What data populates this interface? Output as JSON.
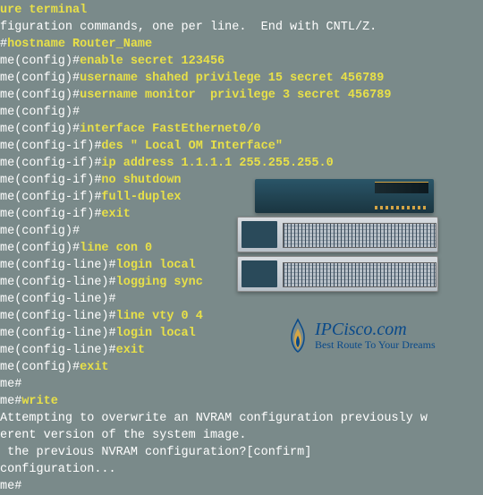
{
  "terminal": {
    "lines": [
      [
        {
          "t": "ure terminal",
          "c": "y"
        }
      ],
      [
        {
          "t": "figuration commands, one per line.  End with CNTL/Z.",
          "c": "w"
        }
      ],
      [
        {
          "t": "#",
          "c": "w"
        },
        {
          "t": "hostname Router_Name",
          "c": "y"
        }
      ],
      [
        {
          "t": "me(config)#",
          "c": "w"
        },
        {
          "t": "enable secret 123456",
          "c": "y"
        }
      ],
      [
        {
          "t": "me(config)#",
          "c": "w"
        },
        {
          "t": "username shahed privilege 15 secret 456789",
          "c": "y"
        }
      ],
      [
        {
          "t": "me(config)#",
          "c": "w"
        },
        {
          "t": "username monitor  privilege 3 secret 456789",
          "c": "y"
        }
      ],
      [
        {
          "t": "me(config)#",
          "c": "w"
        }
      ],
      [
        {
          "t": "me(config)#",
          "c": "w"
        },
        {
          "t": "interface FastEthernet0/0",
          "c": "y"
        }
      ],
      [
        {
          "t": "me(config-if)#",
          "c": "w"
        },
        {
          "t": "des \" Local OM Interface\"",
          "c": "y"
        }
      ],
      [
        {
          "t": "me(config-if)#",
          "c": "w"
        },
        {
          "t": "ip address 1.1.1.1 255.255.255.0",
          "c": "y"
        }
      ],
      [
        {
          "t": "me(config-if)#",
          "c": "w"
        },
        {
          "t": "no shutdown",
          "c": "y"
        }
      ],
      [
        {
          "t": "me(config-if)#",
          "c": "w"
        },
        {
          "t": "full-duplex",
          "c": "y"
        }
      ],
      [
        {
          "t": "me(config-if)#",
          "c": "w"
        },
        {
          "t": "exit",
          "c": "y"
        }
      ],
      [
        {
          "t": "me(config)#",
          "c": "w"
        }
      ],
      [
        {
          "t": "me(config)#",
          "c": "w"
        },
        {
          "t": "line con 0",
          "c": "y"
        }
      ],
      [
        {
          "t": "me(config-line)#",
          "c": "w"
        },
        {
          "t": "login local",
          "c": "y"
        }
      ],
      [
        {
          "t": "me(config-line)#",
          "c": "w"
        },
        {
          "t": "logging sync",
          "c": "y"
        }
      ],
      [
        {
          "t": "me(config-line)#",
          "c": "w"
        }
      ],
      [
        {
          "t": "me(config-line)#",
          "c": "w"
        },
        {
          "t": "line vty 0 4",
          "c": "y"
        }
      ],
      [
        {
          "t": "me(config-line)#",
          "c": "w"
        },
        {
          "t": "login local",
          "c": "y"
        }
      ],
      [
        {
          "t": "me(config-line)#",
          "c": "w"
        },
        {
          "t": "exit",
          "c": "y"
        }
      ],
      [
        {
          "t": "me(config)#",
          "c": "w"
        },
        {
          "t": "exit",
          "c": "y"
        }
      ],
      [
        {
          "t": "me#",
          "c": "w"
        }
      ],
      [
        {
          "t": "me#",
          "c": "w"
        },
        {
          "t": "write",
          "c": "y"
        }
      ],
      [
        {
          "t": "Attempting to overwrite an NVRAM configuration previously w",
          "c": "w"
        }
      ],
      [
        {
          "t": "erent version of the system image.",
          "c": "w"
        }
      ],
      [
        {
          "t": " the previous NVRAM configuration?[confirm]",
          "c": "w"
        }
      ],
      [
        {
          "t": "configuration...",
          "c": "w"
        }
      ],
      [
        {
          "t": "",
          "c": "w"
        }
      ],
      [
        {
          "t": "me#",
          "c": "w"
        }
      ]
    ]
  },
  "logo": {
    "main": "IPCisco.com",
    "sub": "Best Route To Your Dreams"
  },
  "colors": {
    "bg": "#7a8a8a",
    "command": "#e8e048",
    "text": "#ffffff",
    "brand": "#0a4a8a",
    "accent": "#d4a545"
  }
}
